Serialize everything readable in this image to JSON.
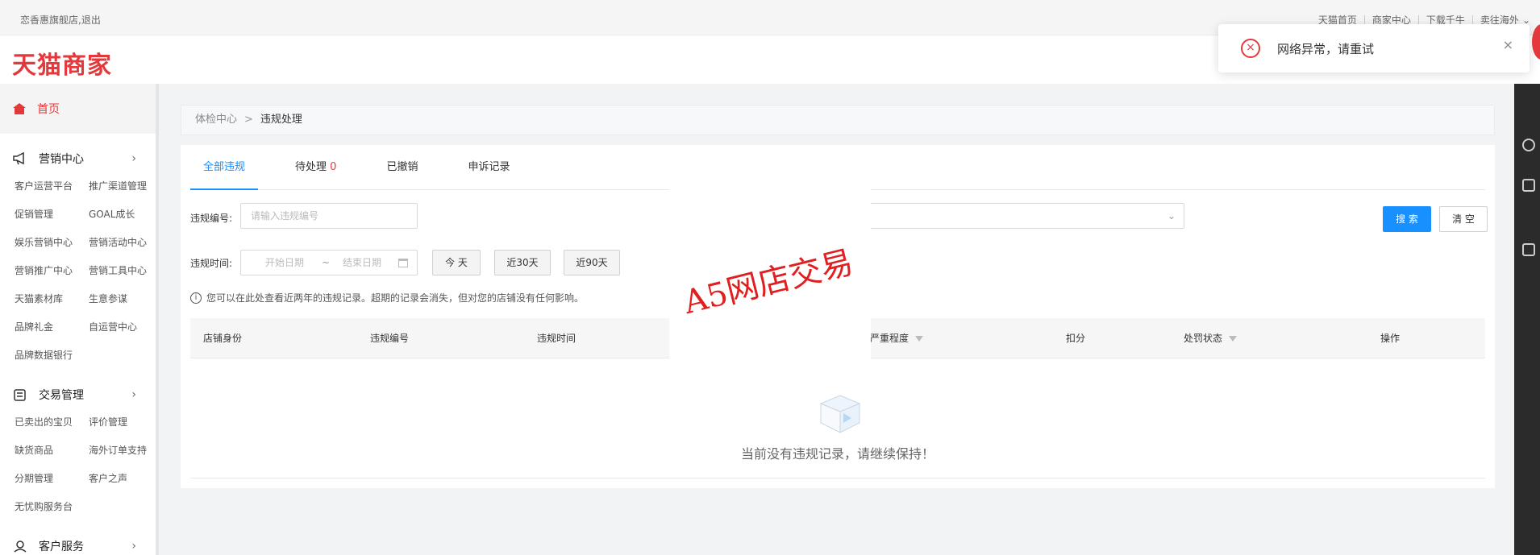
{
  "topbar": {
    "user": "恋香惠旗舰店,退出",
    "links": [
      "天猫首页",
      "商家中心",
      "下载千牛",
      "卖往海外"
    ]
  },
  "header": {
    "logo": "天猫商家"
  },
  "sidebar": {
    "home": "首页",
    "sections": [
      {
        "title": "营销中心",
        "icon": "megaphone-icon",
        "items": [
          "客户运营平台",
          "推广渠道管理",
          "促销管理",
          "GOAL成长",
          "娱乐营销中心",
          "营销活动中心",
          "营销推广中心",
          "营销工具中心",
          "天猫素材库",
          "生意参谋",
          "品牌礼金",
          "自运营中心",
          "品牌数据银行"
        ]
      },
      {
        "title": "交易管理",
        "icon": "order-icon",
        "items": [
          "已卖出的宝贝",
          "评价管理",
          "缺货商品",
          "海外订单支持",
          "分期管理",
          "客户之声",
          "无忧购服务台"
        ]
      },
      {
        "title": "客户服务",
        "icon": "customer-icon",
        "items": []
      }
    ]
  },
  "breadcrumb": {
    "parent": "体检中心",
    "separator": ">",
    "current": "违规处理"
  },
  "tabs": [
    {
      "label": "全部违规",
      "count": ""
    },
    {
      "label": "待处理",
      "count": "0"
    },
    {
      "label": "已撤销",
      "count": ""
    },
    {
      "label": "申诉记录",
      "count": ""
    }
  ],
  "filters": {
    "id_label": "违规编号:",
    "id_placeholder": "请输入违规编号",
    "time_label": "违规时间:",
    "start_placeholder": "开始日期",
    "range_sep": "~",
    "end_placeholder": "结束日期",
    "quick": [
      "今 天",
      "近30天",
      "近90天"
    ],
    "search": "搜 索",
    "clear": "清 空"
  },
  "tip": "您可以在此处查看近两年的违规记录。超期的记录会消失，但对您的店铺没有任何影响。",
  "table": {
    "headers": [
      "店铺身份",
      "违规编号",
      "违规时间",
      "严重程度",
      "扣分",
      "处罚状态",
      "操作"
    ]
  },
  "empty_text": "当前没有违规记录，请继续保持！",
  "watermark": "A5网店交易",
  "toast": {
    "message": "网络异常，请重试",
    "close": "×"
  },
  "colors": {
    "brand_red": "#e4393c",
    "primary_blue": "#1890ff"
  }
}
